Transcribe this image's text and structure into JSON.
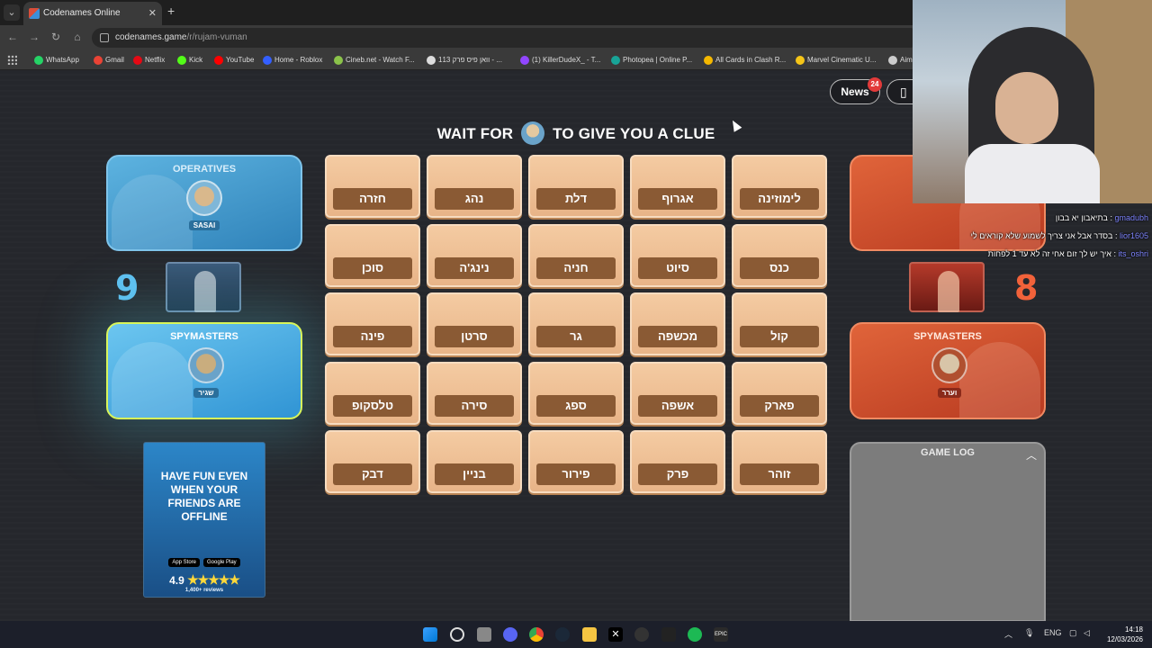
{
  "browser": {
    "tab_title": "Codenames Online",
    "url_host": "codenames.game",
    "url_path": "/r/rujam-vuman",
    "bookmarks": [
      {
        "label": "WhatsApp",
        "color": "#25d366"
      },
      {
        "label": "Gmail",
        "color": "#ea4335"
      },
      {
        "label": "Netflix",
        "color": "#e50914"
      },
      {
        "label": "Kick",
        "color": "#53fc18"
      },
      {
        "label": "YouTube",
        "color": "#ff0000"
      },
      {
        "label": "Home - Roblox",
        "color": "#335fff"
      },
      {
        "label": "Cineb.net - Watch F...",
        "color": "#8bc34a"
      },
      {
        "label": "וואן פיס פרק 113 - ...",
        "color": "#dddddd"
      },
      {
        "label": "(1) KillerDudeX_ - T...",
        "color": "#9146ff"
      },
      {
        "label": "Photopea | Online P...",
        "color": "#18a497"
      },
      {
        "label": "All Cards in Clash R...",
        "color": "#f5b800"
      },
      {
        "label": "Marvel Cinematic U...",
        "color": "#f5c518"
      },
      {
        "label": "Aim",
        "color": "#cccccc"
      }
    ]
  },
  "header": {
    "news_label": "News",
    "news_badge": "24",
    "clue_prefix": "WAIT FOR",
    "clue_suffix": "TO GIVE YOU A CLUE"
  },
  "blue_team": {
    "operatives_title": "OPERATIVES",
    "operative_name": "SASAI",
    "score": "9",
    "spymasters_title": "SPYMASTERS",
    "spymaster_name": "שגיר"
  },
  "red_team": {
    "score": "8",
    "spymasters_title": "SPYMASTERS",
    "spymaster_name": "וערר"
  },
  "cards": [
    "חזרה",
    "נהג",
    "דלת",
    "אגרוף",
    "לימוזינה",
    "סוכן",
    "נינג'ה",
    "חניה",
    "סיוט",
    "כנס",
    "פינה",
    "סרטן",
    "גר",
    "מכשפה",
    "קול",
    "טלסקופ",
    "סירה",
    "ספג",
    "אשפה",
    "פארק",
    "דבק",
    "בניין",
    "פירור",
    "פרק",
    "זוהר"
  ],
  "ad": {
    "headline": "HAVE FUN EVEN WHEN YOUR FRIENDS ARE OFFLINE",
    "app_store": "App Store",
    "google_play": "Google Play",
    "rating": "4.9",
    "stars": "★★★★★",
    "reviews": "1,400+ reviews"
  },
  "game_log": {
    "title": "GAME LOG"
  },
  "chat": [
    {
      "user": "gmadubh",
      "text": "בתיאבון יא בבון"
    },
    {
      "user": "lior1605",
      "text": "בסדר אבל אני צריך לשמוע שלא קוראים לי"
    },
    {
      "user": "its_oshri",
      "text": "איך יש לך זום אחי זה לא עד 1 לפחות"
    }
  ],
  "taskbar": {
    "lang": "ENG",
    "time": "14:18",
    "date": "12/03/2026"
  },
  "colors": {
    "blue_team": "#3094d4",
    "red_team": "#b83a20",
    "card_face": "#e8b488",
    "card_label": "#8a5a34"
  }
}
